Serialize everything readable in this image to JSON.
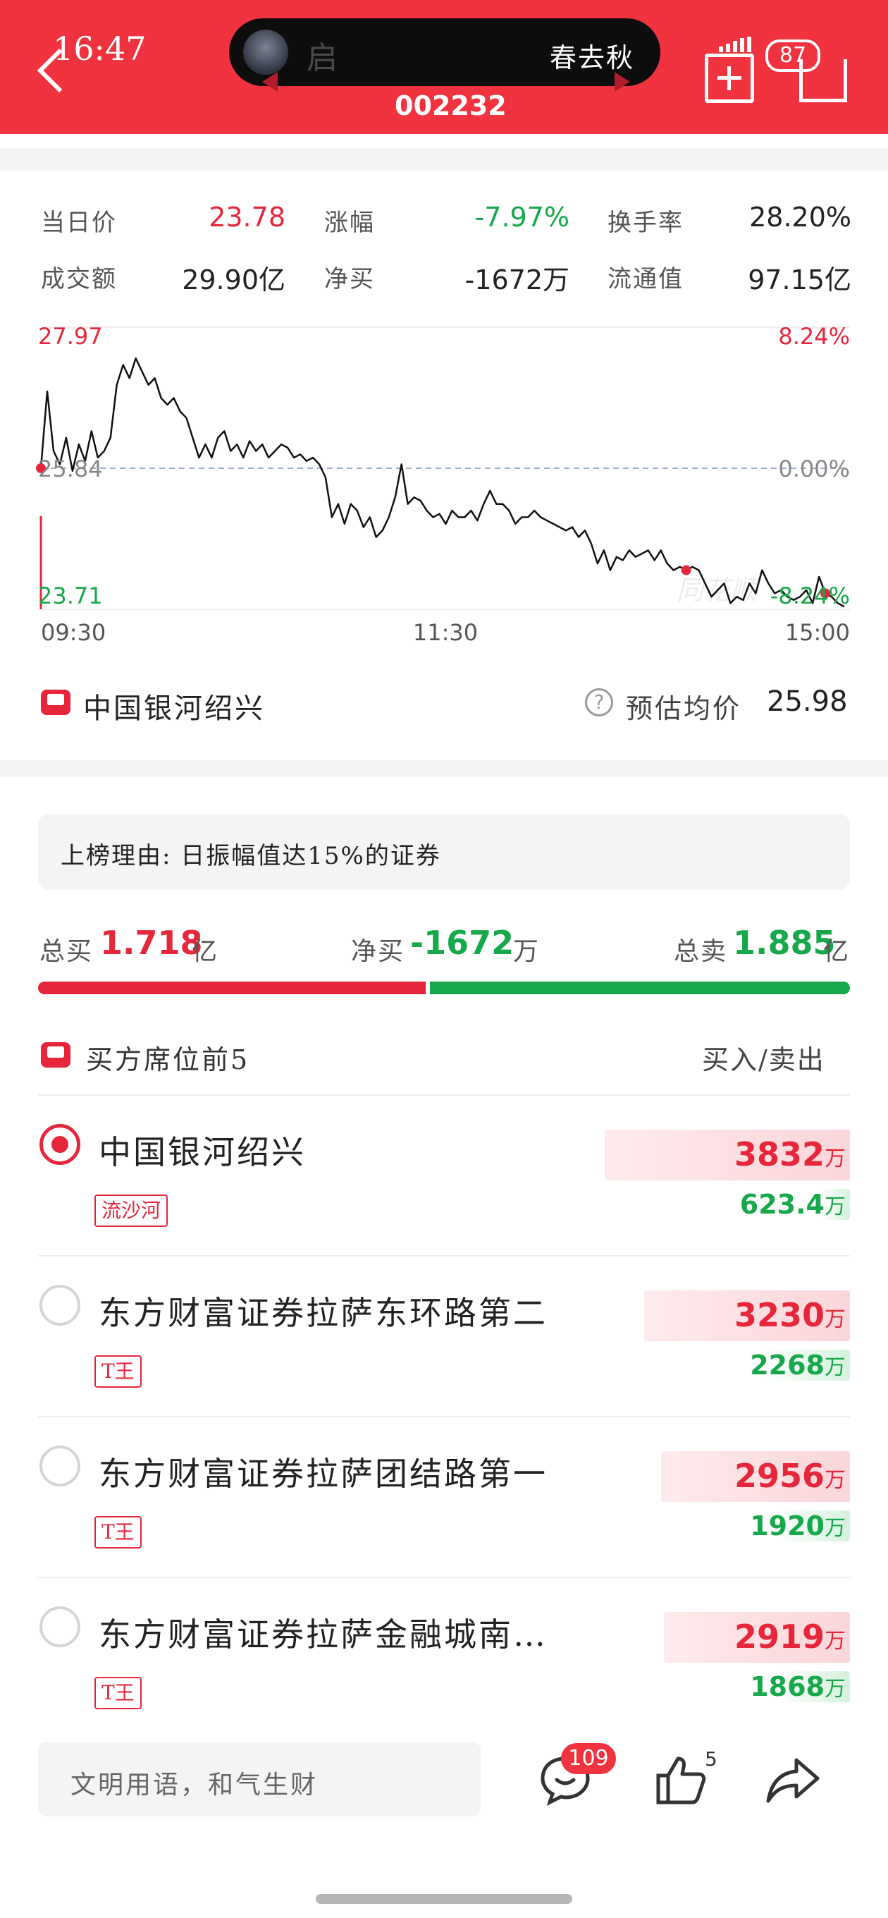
{
  "status_bar": {
    "time": "16:47"
  },
  "header": {
    "pill_text": "春去秋",
    "pill_ghost": "启",
    "stock_code": "002232",
    "badge_count": "87"
  },
  "stats": {
    "rows": [
      [
        {
          "label": "当日价",
          "value": "23.78",
          "color": "red"
        },
        {
          "label": "涨幅",
          "value": "-7.97%",
          "color": "green"
        },
        {
          "label": "换手率",
          "value": "28.20%",
          "color": "black"
        }
      ],
      [
        {
          "label": "成交额",
          "value": "29.90亿",
          "color": "black"
        },
        {
          "label": "净买",
          "value": "-1672万",
          "color": "black"
        },
        {
          "label": "流通值",
          "value": "97.15亿",
          "color": "black"
        }
      ]
    ]
  },
  "chart_data": {
    "type": "line",
    "y_high_label": "27.97",
    "y_mid_label": "25.84",
    "y_low_label": "23.71",
    "pct_high_label": "8.24%",
    "pct_mid_label": "0.00%",
    "pct_low_label": "-8.24%",
    "x_labels": [
      "09:30",
      "11:30",
      "15:00"
    ],
    "ylim": [
      23.71,
      27.97
    ],
    "reference_price": 25.84,
    "watermark": "同花顺",
    "series": [
      {
        "values": [
          25.84,
          27.0,
          26.1,
          25.9,
          26.3,
          25.8,
          26.2,
          25.95,
          26.4,
          26.0,
          26.1,
          26.3,
          27.1,
          27.4,
          27.2,
          27.5,
          27.3,
          27.1,
          27.2,
          26.9,
          26.8,
          26.9,
          26.7,
          26.6,
          26.3,
          26.0,
          26.2,
          26.0,
          26.3,
          26.4,
          26.1,
          26.2,
          26.0,
          26.25,
          26.1,
          26.2,
          26.0,
          26.1,
          26.2,
          26.15,
          26.0,
          26.05,
          25.95,
          26.0,
          25.9,
          25.7,
          25.1,
          25.3,
          25.0,
          25.3,
          25.2,
          24.95,
          25.1,
          24.8,
          24.9,
          25.1,
          25.4,
          25.9,
          25.3,
          25.4,
          25.35,
          25.2,
          25.1,
          25.15,
          25.0,
          25.2,
          25.1,
          25.1,
          25.2,
          25.05,
          25.3,
          25.5,
          25.3,
          25.3,
          25.2,
          25.0,
          25.1,
          25.1,
          25.2,
          25.1,
          25.05,
          25.0,
          24.95,
          24.9,
          24.95,
          24.8,
          24.9,
          24.7,
          24.4,
          24.6,
          24.3,
          24.5,
          24.45,
          24.6,
          24.5,
          24.55,
          24.6,
          24.45,
          24.6,
          24.4,
          24.3,
          24.35,
          24.3,
          24.35,
          24.3,
          24.1,
          23.9,
          24.0,
          24.1,
          23.8,
          23.9,
          23.85,
          24.1,
          23.95,
          24.3,
          24.1,
          23.95,
          24.0,
          23.9,
          23.85,
          23.9,
          24.0,
          23.8,
          24.2,
          23.95,
          23.9,
          23.8,
          23.75
        ]
      }
    ],
    "markers": [
      {
        "index": 0
      },
      {
        "index": 102
      },
      {
        "index": 124
      }
    ]
  },
  "seller": {
    "name": "中国银河绍兴",
    "avg_price_label": "预估均价",
    "avg_price_value": "25.98"
  },
  "reason": "上榜理由: 日振幅值达15%的证券",
  "summary": {
    "total_buy_label": "总买",
    "total_buy_value": "1.718",
    "total_buy_unit": "亿",
    "net_buy_label": "净买",
    "net_buy_value": "-1672",
    "net_buy_unit": "万",
    "total_sell_label": "总卖",
    "total_sell_value": "1.885",
    "total_sell_unit": "亿",
    "buy_share": 0.477
  },
  "buyers": {
    "section_title": "买方席位前5",
    "right_label": "买入/卖出",
    "rows": [
      {
        "name": "中国银河绍兴",
        "tag": "流沙河",
        "buy": "3832",
        "sell": "623.4",
        "selected": true,
        "buy_frac": 1.0,
        "sell_frac": 0.2
      },
      {
        "name": "东方财富证券拉萨东环路第二",
        "tag": "T王",
        "buy": "3230",
        "sell": "2268",
        "selected": false,
        "buy_frac": 0.84,
        "sell_frac": 0.59
      },
      {
        "name": "东方财富证券拉萨团结路第一",
        "tag": "T王",
        "buy": "2956",
        "sell": "1920",
        "selected": false,
        "buy_frac": 0.77,
        "sell_frac": 0.5
      },
      {
        "name": "东方财富证券拉萨金融城南…",
        "tag": "T王",
        "buy": "2919",
        "sell": "1868",
        "selected": false,
        "buy_frac": 0.76,
        "sell_frac": 0.49
      }
    ],
    "unit": "万"
  },
  "bottom_bar": {
    "comment_placeholder": "文明用语，和气生财",
    "comment_count": "109",
    "like_count": "5"
  }
}
